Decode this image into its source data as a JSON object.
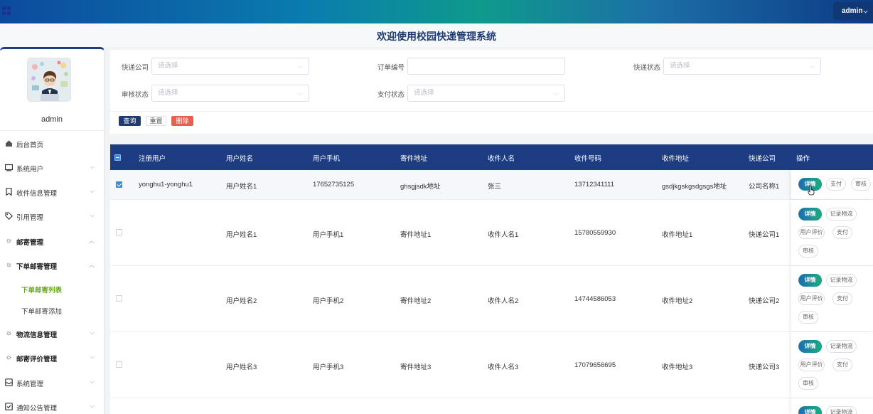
{
  "header": {
    "admin_label": "admin",
    "caret": "⌵"
  },
  "title": "欢迎使用校园快递管理系统",
  "sidebar": {
    "username": "admin",
    "items": [
      {
        "label": "后台首页",
        "icon": "home-icon"
      },
      {
        "label": "系统用户",
        "icon": "monitor-icon"
      },
      {
        "label": "收件信息管理",
        "icon": "bookmark-icon"
      },
      {
        "label": "引用管理",
        "icon": "tag-icon"
      },
      {
        "label": "邮寄管理",
        "icon": "sun-icon"
      },
      {
        "label": "下单邮寄管理",
        "icon": "sun-icon"
      },
      {
        "label": "物流信息管理",
        "icon": "sun-icon"
      },
      {
        "label": "邮寄评价管理",
        "icon": "sun-icon"
      },
      {
        "label": "系统管理",
        "icon": "inbox-icon"
      },
      {
        "label": "通知公告管理",
        "icon": "checkbox-icon"
      }
    ],
    "subitems": [
      {
        "label": "下单邮寄列表",
        "active": true
      },
      {
        "label": "下单邮寄添加",
        "active": false
      }
    ]
  },
  "search": {
    "fields": [
      {
        "label": "快递公司",
        "placeholder": "请选择"
      },
      {
        "label": "订单编号",
        "placeholder": ""
      },
      {
        "label": "快递状态",
        "placeholder": "请选择"
      },
      {
        "label": "审核状态",
        "placeholder": "请选择"
      },
      {
        "label": "支付状态",
        "placeholder": "请选择"
      }
    ],
    "query_label": "查询",
    "reset_label": "重置",
    "delete_label": "删除"
  },
  "table": {
    "headers": [
      "注册用户",
      "用户姓名",
      "用户手机",
      "寄件地址",
      "收件人名",
      "收件号码",
      "收件地址",
      "快递公司",
      "操作"
    ],
    "rows": [
      [
        "yonghu1-yonghu1",
        "用户姓名1",
        "17652735125",
        "ghsgjsdk地址",
        "张三",
        "13712341111",
        "gsdjkgskgsdgsgs地址",
        "公司名称1"
      ],
      [
        "",
        "用户姓名1",
        "用户手机1",
        "寄件地址1",
        "收件人名1",
        "15780559930",
        "收件地址1",
        "快递公司1"
      ],
      [
        "",
        "用户姓名2",
        "用户手机2",
        "寄件地址2",
        "收件人名2",
        "14744586053",
        "收件地址2",
        "快递公司2"
      ],
      [
        "",
        "用户姓名3",
        "用户手机3",
        "寄件地址3",
        "收件人名3",
        "17079656695",
        "收件地址3",
        "快递公司3"
      ]
    ],
    "ops": {
      "detail": "详情",
      "pay": "支付",
      "audit": "审核",
      "logistics": "记录物流",
      "review": "用户评价"
    }
  }
}
